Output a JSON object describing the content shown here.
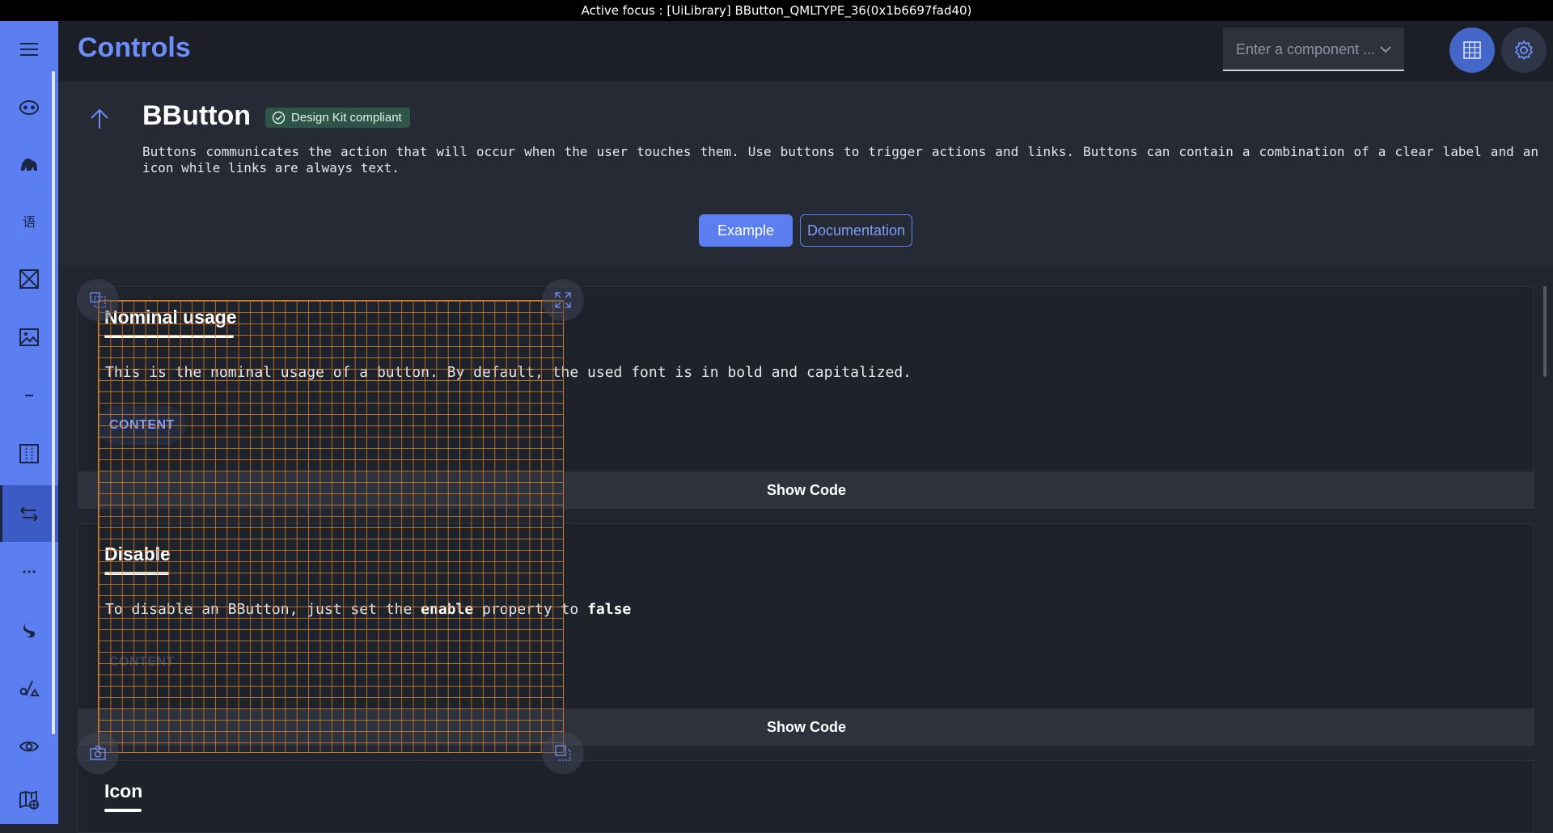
{
  "window": {
    "title": "Active focus : [UiLibrary] BButton_QMLTYPE_36(0x1b6697fad40)"
  },
  "header": {
    "title": "Controls",
    "search_placeholder": "Enter a component ...",
    "chevron": "⌵"
  },
  "sidebar": {
    "items": [
      {
        "icon": "menu-icon"
      },
      {
        "icon": "mask-icon"
      },
      {
        "icon": "animal-icon"
      },
      {
        "icon": "language-icon",
        "glyph": "语"
      },
      {
        "icon": "box-cross-icon"
      },
      {
        "icon": "image-icon"
      },
      {
        "icon": "divider-icon"
      },
      {
        "icon": "columns-icon"
      },
      {
        "icon": "swap-icon",
        "active": true
      },
      {
        "icon": "more-icon"
      },
      {
        "icon": "spinner-icon"
      },
      {
        "icon": "shapes-icon"
      },
      {
        "icon": "eye-icon"
      },
      {
        "icon": "map-icon"
      }
    ]
  },
  "component": {
    "name": "BButton",
    "badge": "Design Kit compliant",
    "description": "Buttons communicates the action that will occur when the user touches them. Use buttons to trigger actions and links. Buttons can contain a combination of a clear label and an icon while links are always text.",
    "tabs": {
      "example": "Example",
      "documentation": "Documentation"
    }
  },
  "sections": {
    "nominal": {
      "title": "Nominal usage",
      "description": "This is the nominal usage of a button. By default, the used font is in bold and capitalized.",
      "button": "CONTENT",
      "show_code": "Show Code"
    },
    "disable": {
      "title": "Disable",
      "desc_pre": "To disable an BButton, just set the ",
      "desc_kw1": "enable",
      "desc_mid": " property to ",
      "desc_kw2": "false",
      "button": "CONTENT",
      "show_code": "Show Code"
    },
    "icon": {
      "title": "Icon"
    }
  },
  "colors": {
    "accent": "#5b7ff0",
    "badge_bg": "#2f5448",
    "grid_overlay": "#de8228"
  }
}
